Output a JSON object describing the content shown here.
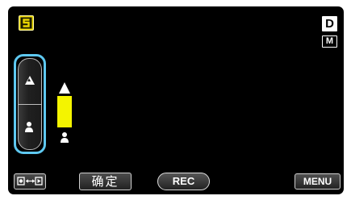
{
  "screen": {
    "background": "#000000"
  },
  "top_left": {
    "mode_icon": "scene-mode-icon",
    "mode_color": "#e8d400"
  },
  "top_right": {
    "display_label": "D",
    "manual_label": "M"
  },
  "focus_rocker": {
    "far_icon": "far-mountain-icon",
    "near_icon": "near-person-icon",
    "outline_color": "#5ec8f0"
  },
  "focus_level": {
    "far_icon": "far-mountain-icon",
    "near_icon": "near-person-icon",
    "bar_color": "#f4f400"
  },
  "bottom_bar": {
    "change_icon": "display-switch-icon",
    "confirm_label": "确定",
    "rec_label": "REC",
    "menu_label": "MENU"
  }
}
